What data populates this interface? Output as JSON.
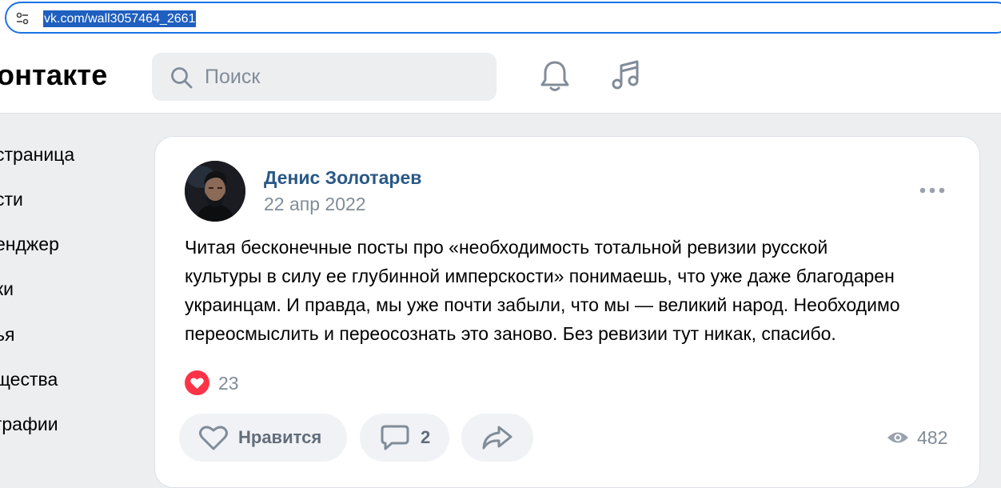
{
  "browser": {
    "url": "vk.com/wall3057464_2661"
  },
  "header": {
    "logo_text": "онтакте",
    "search_placeholder": "Поиск"
  },
  "sidebar": {
    "items": [
      {
        "label": "страница"
      },
      {
        "label": "сти"
      },
      {
        "label": "енджер"
      },
      {
        "label": "ки"
      },
      {
        "label": "ья"
      },
      {
        "label": "щества"
      },
      {
        "label": "графии"
      }
    ]
  },
  "post": {
    "author": "Денис Золотарев",
    "date": "22 апр 2022",
    "text_lines": [
      "Читая бесконечные посты про «необходимость тотальной ревизии русской",
      "культуры в силу ее глубинной имперскости» понимаешь, что уже даже благодарен",
      "украинцам. И правда, мы уже почти забыли, что мы — великий народ. Необходимо",
      "переосмыслить и переосознать это заново. Без ревизии тут никак, спасибо."
    ],
    "reactions_count": "23",
    "like_label": "Нравится",
    "comments_count": "2",
    "views_count": "482"
  },
  "colors": {
    "accent_link": "#2a5885",
    "muted": "#818c99",
    "reaction_red": "#ff3347",
    "browser_focus": "#1a73e8"
  }
}
